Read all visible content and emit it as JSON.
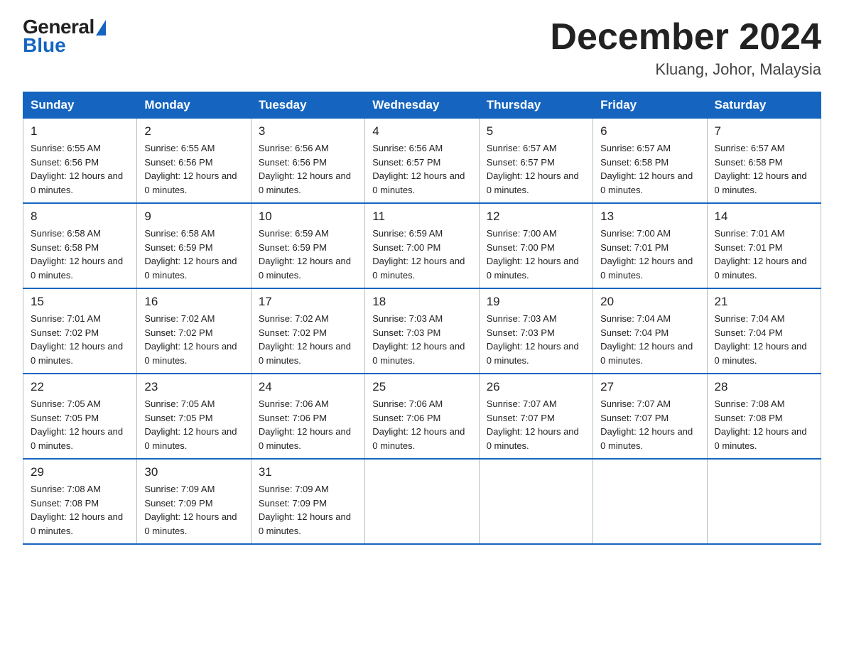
{
  "logo": {
    "general": "General",
    "blue": "Blue"
  },
  "title": {
    "month_year": "December 2024",
    "location": "Kluang, Johor, Malaysia"
  },
  "headers": [
    "Sunday",
    "Monday",
    "Tuesday",
    "Wednesday",
    "Thursday",
    "Friday",
    "Saturday"
  ],
  "weeks": [
    [
      {
        "day": "1",
        "sunrise": "6:55 AM",
        "sunset": "6:56 PM",
        "daylight": "12 hours and 0 minutes."
      },
      {
        "day": "2",
        "sunrise": "6:55 AM",
        "sunset": "6:56 PM",
        "daylight": "12 hours and 0 minutes."
      },
      {
        "day": "3",
        "sunrise": "6:56 AM",
        "sunset": "6:56 PM",
        "daylight": "12 hours and 0 minutes."
      },
      {
        "day": "4",
        "sunrise": "6:56 AM",
        "sunset": "6:57 PM",
        "daylight": "12 hours and 0 minutes."
      },
      {
        "day": "5",
        "sunrise": "6:57 AM",
        "sunset": "6:57 PM",
        "daylight": "12 hours and 0 minutes."
      },
      {
        "day": "6",
        "sunrise": "6:57 AM",
        "sunset": "6:58 PM",
        "daylight": "12 hours and 0 minutes."
      },
      {
        "day": "7",
        "sunrise": "6:57 AM",
        "sunset": "6:58 PM",
        "daylight": "12 hours and 0 minutes."
      }
    ],
    [
      {
        "day": "8",
        "sunrise": "6:58 AM",
        "sunset": "6:58 PM",
        "daylight": "12 hours and 0 minutes."
      },
      {
        "day": "9",
        "sunrise": "6:58 AM",
        "sunset": "6:59 PM",
        "daylight": "12 hours and 0 minutes."
      },
      {
        "day": "10",
        "sunrise": "6:59 AM",
        "sunset": "6:59 PM",
        "daylight": "12 hours and 0 minutes."
      },
      {
        "day": "11",
        "sunrise": "6:59 AM",
        "sunset": "7:00 PM",
        "daylight": "12 hours and 0 minutes."
      },
      {
        "day": "12",
        "sunrise": "7:00 AM",
        "sunset": "7:00 PM",
        "daylight": "12 hours and 0 minutes."
      },
      {
        "day": "13",
        "sunrise": "7:00 AM",
        "sunset": "7:01 PM",
        "daylight": "12 hours and 0 minutes."
      },
      {
        "day": "14",
        "sunrise": "7:01 AM",
        "sunset": "7:01 PM",
        "daylight": "12 hours and 0 minutes."
      }
    ],
    [
      {
        "day": "15",
        "sunrise": "7:01 AM",
        "sunset": "7:02 PM",
        "daylight": "12 hours and 0 minutes."
      },
      {
        "day": "16",
        "sunrise": "7:02 AM",
        "sunset": "7:02 PM",
        "daylight": "12 hours and 0 minutes."
      },
      {
        "day": "17",
        "sunrise": "7:02 AM",
        "sunset": "7:02 PM",
        "daylight": "12 hours and 0 minutes."
      },
      {
        "day": "18",
        "sunrise": "7:03 AM",
        "sunset": "7:03 PM",
        "daylight": "12 hours and 0 minutes."
      },
      {
        "day": "19",
        "sunrise": "7:03 AM",
        "sunset": "7:03 PM",
        "daylight": "12 hours and 0 minutes."
      },
      {
        "day": "20",
        "sunrise": "7:04 AM",
        "sunset": "7:04 PM",
        "daylight": "12 hours and 0 minutes."
      },
      {
        "day": "21",
        "sunrise": "7:04 AM",
        "sunset": "7:04 PM",
        "daylight": "12 hours and 0 minutes."
      }
    ],
    [
      {
        "day": "22",
        "sunrise": "7:05 AM",
        "sunset": "7:05 PM",
        "daylight": "12 hours and 0 minutes."
      },
      {
        "day": "23",
        "sunrise": "7:05 AM",
        "sunset": "7:05 PM",
        "daylight": "12 hours and 0 minutes."
      },
      {
        "day": "24",
        "sunrise": "7:06 AM",
        "sunset": "7:06 PM",
        "daylight": "12 hours and 0 minutes."
      },
      {
        "day": "25",
        "sunrise": "7:06 AM",
        "sunset": "7:06 PM",
        "daylight": "12 hours and 0 minutes."
      },
      {
        "day": "26",
        "sunrise": "7:07 AM",
        "sunset": "7:07 PM",
        "daylight": "12 hours and 0 minutes."
      },
      {
        "day": "27",
        "sunrise": "7:07 AM",
        "sunset": "7:07 PM",
        "daylight": "12 hours and 0 minutes."
      },
      {
        "day": "28",
        "sunrise": "7:08 AM",
        "sunset": "7:08 PM",
        "daylight": "12 hours and 0 minutes."
      }
    ],
    [
      {
        "day": "29",
        "sunrise": "7:08 AM",
        "sunset": "7:08 PM",
        "daylight": "12 hours and 0 minutes."
      },
      {
        "day": "30",
        "sunrise": "7:09 AM",
        "sunset": "7:09 PM",
        "daylight": "12 hours and 0 minutes."
      },
      {
        "day": "31",
        "sunrise": "7:09 AM",
        "sunset": "7:09 PM",
        "daylight": "12 hours and 0 minutes."
      },
      null,
      null,
      null,
      null
    ]
  ],
  "labels": {
    "sunrise_prefix": "Sunrise: ",
    "sunset_prefix": "Sunset: ",
    "daylight_prefix": "Daylight: "
  }
}
